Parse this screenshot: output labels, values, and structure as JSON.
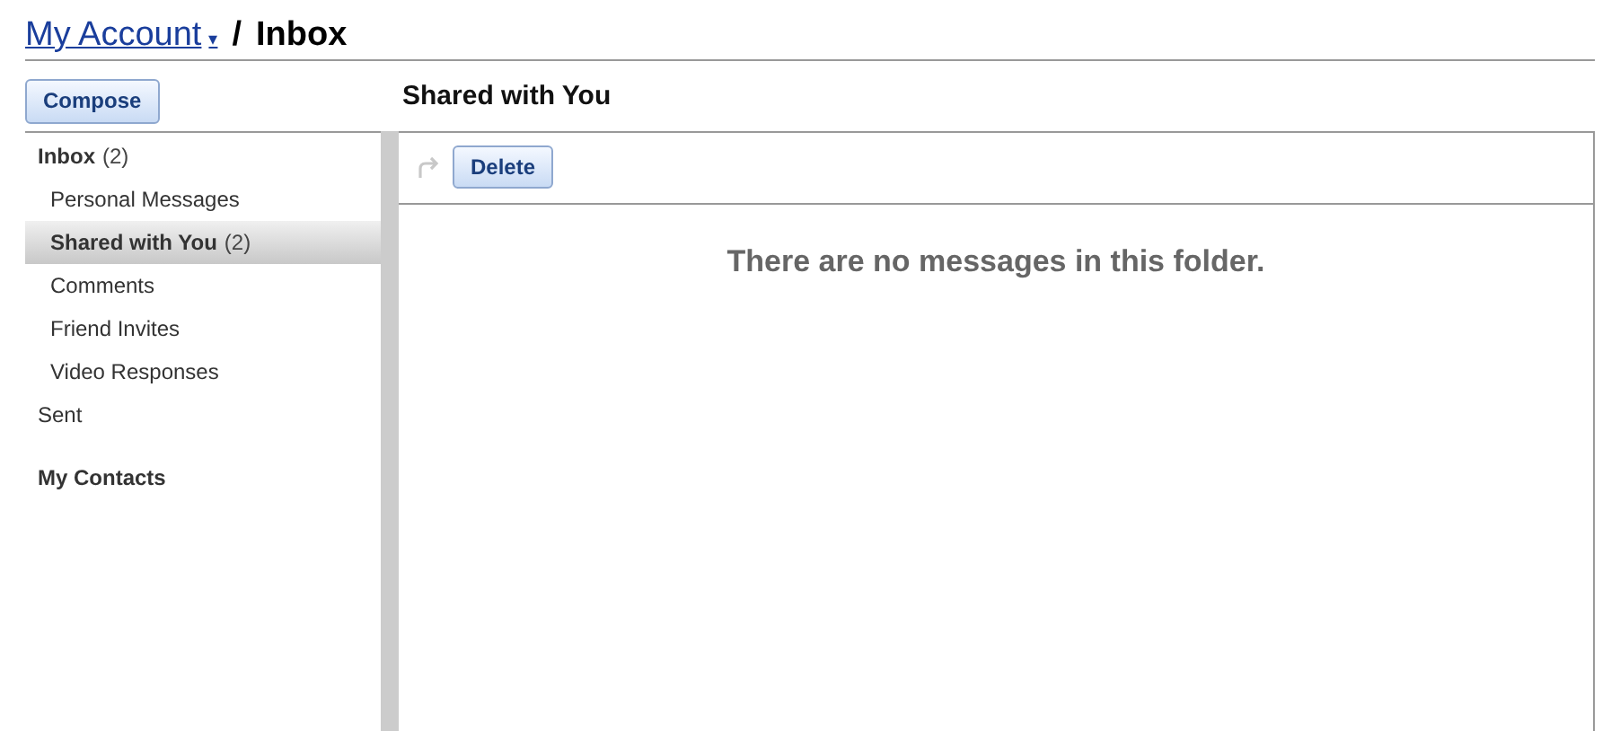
{
  "breadcrumb": {
    "account": "My Account",
    "caret": "▾",
    "separator": "/",
    "current": "Inbox"
  },
  "compose": "Compose",
  "folder_title": "Shared with You",
  "folders": [
    {
      "label": "Inbox",
      "count": "(2)",
      "selected": false,
      "children": [
        {
          "label": "Personal Messages",
          "selected": false
        },
        {
          "label": "Shared with You",
          "count": "(2)",
          "selected": true
        },
        {
          "label": "Comments",
          "selected": false
        },
        {
          "label": "Friend Invites",
          "selected": false
        },
        {
          "label": "Video Responses",
          "selected": false
        }
      ]
    },
    {
      "label": "Sent",
      "selected": false
    }
  ],
  "contacts": "My Contacts",
  "toolbar": {
    "delete": "Delete"
  },
  "empty_message": "There are no messages in this folder."
}
